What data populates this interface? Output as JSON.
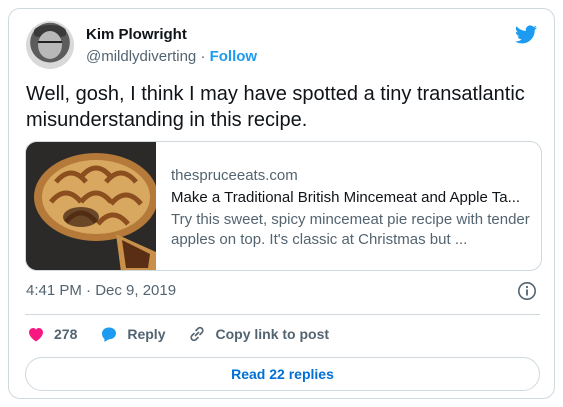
{
  "author": {
    "name": "Kim Plowright",
    "handle": "@mildlydiverting",
    "separator": "·",
    "follow_label": "Follow"
  },
  "tweet": {
    "text": "Well, gosh, I think I may have spotted a tiny transatlantic misunderstanding in this recipe."
  },
  "link_card": {
    "domain": "thespruceeats.com",
    "title": "Make a Traditional British Mincemeat and Apple Ta...",
    "description": "Try this sweet, spicy mincemeat pie recipe with tender apples on top. It's classic at Christmas but ..."
  },
  "meta": {
    "timestamp": "4:41 PM · Dec 9, 2019"
  },
  "actions": {
    "like_count": "278",
    "reply_label": "Reply",
    "copy_label": "Copy link to post"
  },
  "footer": {
    "read_replies_label": "Read 22 replies"
  },
  "colors": {
    "like": "#f91880",
    "reply": "#1d9bf0",
    "link": "#1d9bf0",
    "muted": "#536471",
    "border": "#cfd9de"
  }
}
